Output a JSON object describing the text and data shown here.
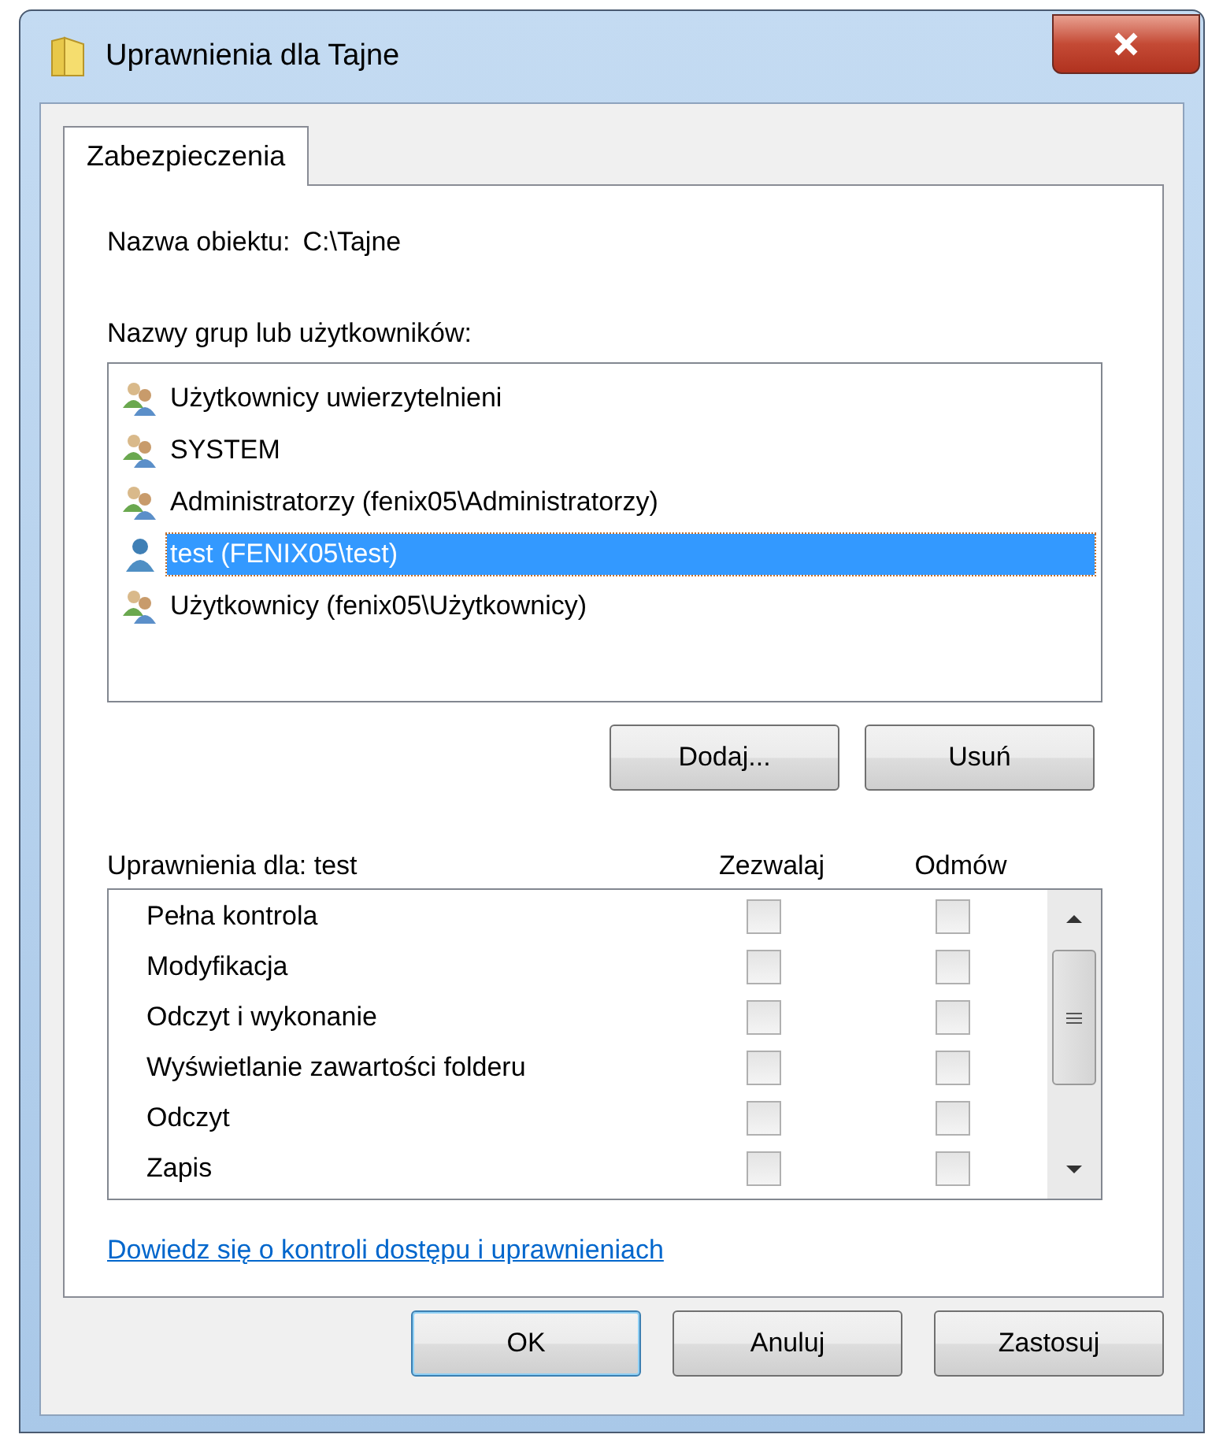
{
  "window": {
    "title": "Uprawnienia dla Tajne"
  },
  "tabs": [
    {
      "label": "Zabezpieczenia",
      "selected": true
    }
  ],
  "object_name": {
    "label": "Nazwa obiektu:",
    "value": "C:\\Tajne"
  },
  "principals": {
    "label": "Nazwy grup lub użytkowników:",
    "items": [
      {
        "name": "Użytkownicy uwierzytelnieni",
        "kind": "group",
        "selected": false
      },
      {
        "name": "SYSTEM",
        "kind": "group",
        "selected": false
      },
      {
        "name": "Administratorzy (fenix05\\Administratorzy)",
        "kind": "group",
        "selected": false
      },
      {
        "name": "test (FENIX05\\test)",
        "kind": "user",
        "selected": true
      },
      {
        "name": "Użytkownicy (fenix05\\Użytkownicy)",
        "kind": "group",
        "selected": false
      }
    ]
  },
  "principal_buttons": [
    "Dodaj...",
    "Usuń"
  ],
  "permissions": {
    "label": "Uprawnienia dla: test",
    "columns": [
      "Zezwalaj",
      "Odmów"
    ],
    "rows": [
      {
        "name": "Pełna kontrola",
        "allow": false,
        "deny": false
      },
      {
        "name": "Modyfikacja",
        "allow": false,
        "deny": false
      },
      {
        "name": "Odczyt i wykonanie",
        "allow": false,
        "deny": false
      },
      {
        "name": "Wyświetlanie zawartości folderu",
        "allow": false,
        "deny": false
      },
      {
        "name": "Odczyt",
        "allow": false,
        "deny": false
      },
      {
        "name": "Zapis",
        "allow": false,
        "deny": false
      }
    ]
  },
  "link": "Dowiedz się o kontroli dostępu i uprawnieniach",
  "footer_buttons": [
    {
      "label": "OK",
      "default": true
    },
    {
      "label": "Anuluj",
      "default": false
    },
    {
      "label": "Zastosuj",
      "default": false
    }
  ]
}
